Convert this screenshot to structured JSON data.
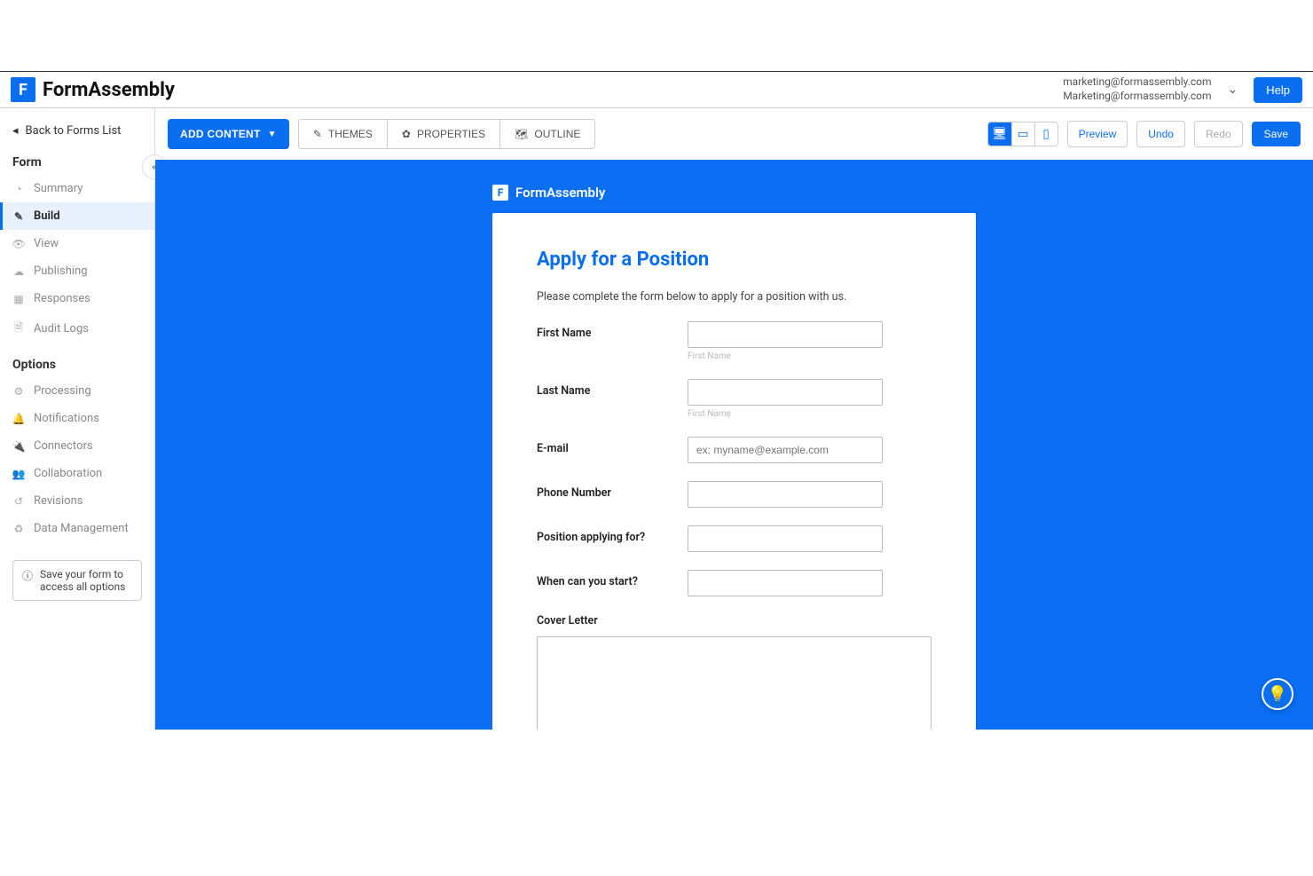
{
  "brand": {
    "mark": "F",
    "name": "FormAssembly"
  },
  "user": {
    "line1": "marketing@formassembly.com",
    "line2": "Marketing@formassembly.com"
  },
  "help_label": "Help",
  "back_label": "Back to Forms List",
  "sidebar": {
    "section_form": "Form",
    "section_options": "Options",
    "form_items": [
      {
        "label": "Summary",
        "icon": "◔"
      },
      {
        "label": "Build",
        "icon": "✎"
      },
      {
        "label": "View",
        "icon": "👁"
      },
      {
        "label": "Publishing",
        "icon": "☁"
      },
      {
        "label": "Responses",
        "icon": "▦"
      },
      {
        "label": "Audit Logs",
        "icon": "🗎"
      }
    ],
    "option_items": [
      {
        "label": "Processing",
        "icon": "⚙"
      },
      {
        "label": "Notifications",
        "icon": "🔔"
      },
      {
        "label": "Connectors",
        "icon": "🔌"
      },
      {
        "label": "Collaboration",
        "icon": "👥"
      },
      {
        "label": "Revisions",
        "icon": "↺"
      },
      {
        "label": "Data Management",
        "icon": "♻"
      }
    ],
    "save_note": "Save your form to access all options"
  },
  "toolbar": {
    "add_content": "ADD CONTENT",
    "themes": "THEMES",
    "properties": "PROPERTIES",
    "outline": "OUTLINE",
    "preview": "Preview",
    "undo": "Undo",
    "redo": "Redo",
    "save": "Save"
  },
  "canvas": {
    "header_mark": "F",
    "header_name": "FormAssembly",
    "form_title": "Apply for a Position",
    "form_intro": "Please complete the form below to apply for a position with us.",
    "fields": {
      "first_name_label": "First Name",
      "first_name_hint": "First Name",
      "last_name_label": "Last Name",
      "last_name_hint": "First Name",
      "email_label": "E-mail",
      "email_placeholder": "ex: myname@example.com",
      "phone_label": "Phone Number",
      "position_label": "Position applying for?",
      "start_label": "When can you start?",
      "cover_label": "Cover Letter"
    }
  }
}
